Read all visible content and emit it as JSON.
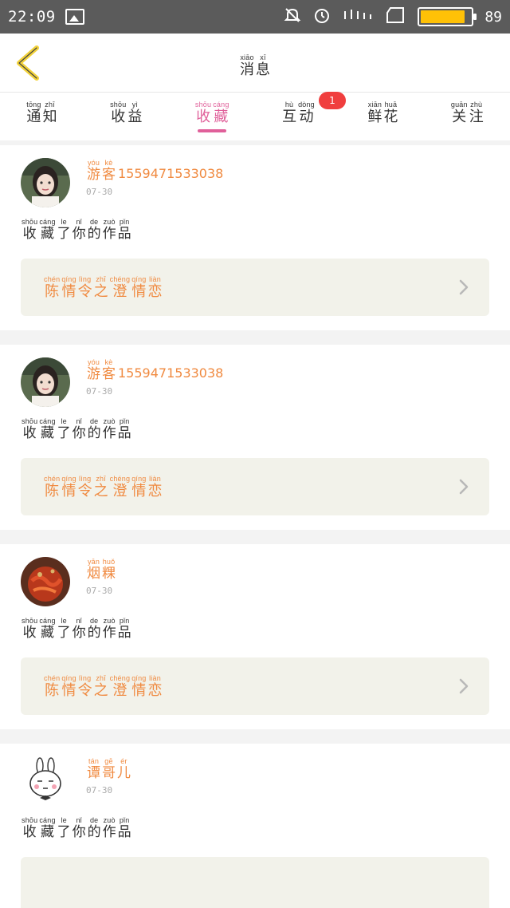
{
  "status": {
    "time": "22:09",
    "battery": "89",
    "battery_level": 0.89
  },
  "header": {
    "title_py": [
      "xiāo",
      "xī"
    ],
    "title_hz": [
      "消",
      "息"
    ]
  },
  "tabs": [
    {
      "py": [
        "tōng",
        "zhī"
      ],
      "hz": [
        "通",
        "知"
      ],
      "active": false
    },
    {
      "py": [
        "shōu",
        "yì"
      ],
      "hz": [
        "收",
        "益"
      ],
      "active": false
    },
    {
      "py": [
        "shōu",
        "cáng"
      ],
      "hz": [
        "收",
        "藏"
      ],
      "active": true
    },
    {
      "py": [
        "hù",
        "dòng"
      ],
      "hz": [
        "互",
        "动"
      ],
      "active": false,
      "badge": "1"
    },
    {
      "py": [
        "xiān",
        "huā"
      ],
      "hz": [
        "鲜",
        "花"
      ],
      "active": false
    },
    {
      "py": [
        "guān",
        "zhù"
      ],
      "hz": [
        "关",
        "注"
      ],
      "active": false
    }
  ],
  "items": [
    {
      "avatar": "girl-photo",
      "name_py": [
        "yóu",
        "kè"
      ],
      "name_hz": [
        "游",
        "客"
      ],
      "name_suffix": "15594715330 38",
      "date": "07-30",
      "action_py": [
        "shōu",
        "cáng",
        "le",
        "nǐ",
        "de",
        "zuò",
        "pǐn"
      ],
      "action_hz": [
        "收",
        "藏",
        "了",
        "你",
        "的",
        "作",
        "品"
      ],
      "work_py": [
        "chén",
        "qíng",
        "lìng",
        "zhī",
        "chéng",
        "qíng",
        "liàn"
      ],
      "work_hz": [
        "陈",
        "情",
        "令",
        "之",
        "澄",
        "情",
        "恋"
      ]
    },
    {
      "avatar": "girl-photo",
      "name_py": [
        "yóu",
        "kè"
      ],
      "name_hz": [
        "游",
        "客"
      ],
      "name_suffix": "15594715330 38",
      "date": "07-30",
      "action_py": [
        "shōu",
        "cáng",
        "le",
        "nǐ",
        "de",
        "zuò",
        "pǐn"
      ],
      "action_hz": [
        "收",
        "藏",
        "了",
        "你",
        "的",
        "作",
        "品"
      ],
      "work_py": [
        "chén",
        "qíng",
        "lìng",
        "zhī",
        "chéng",
        "qíng",
        "liàn"
      ],
      "work_hz": [
        "陈",
        "情",
        "令",
        "之",
        "澄",
        "情",
        "恋"
      ]
    },
    {
      "avatar": "food-photo",
      "name_py": [
        "yān",
        "huǒ"
      ],
      "name_hz": [
        "烟",
        "粿"
      ],
      "name_suffix": "",
      "date": "07-30",
      "action_py": [
        "shōu",
        "cáng",
        "le",
        "nǐ",
        "de",
        "zuò",
        "pǐn"
      ],
      "action_hz": [
        "收",
        "藏",
        "了",
        "你",
        "的",
        "作",
        "品"
      ],
      "work_py": [
        "chén",
        "qíng",
        "lìng",
        "zhī",
        "chéng",
        "qíng",
        "liàn"
      ],
      "work_hz": [
        "陈",
        "情",
        "令",
        "之",
        "澄",
        "情",
        "恋"
      ]
    },
    {
      "avatar": "rabbit-cartoon",
      "name_py": [
        "tán",
        "gē",
        "ér"
      ],
      "name_hz": [
        "谭",
        "哥",
        "儿"
      ],
      "name_suffix": "",
      "date": "07-30",
      "action_py": [
        "shōu",
        "cáng",
        "le",
        "nǐ",
        "de",
        "zuò",
        "pǐn"
      ],
      "action_hz": [
        "收",
        "藏",
        "了",
        "你",
        "的",
        "作",
        "品"
      ],
      "work_py": [],
      "work_hz": []
    }
  ],
  "colors": {
    "accent": "#e0609a",
    "orange": "#f08a40",
    "badge": "#f03e3e",
    "back": "#f2d23a"
  },
  "icons": [
    "back-chevron-icon",
    "chevron-right-icon",
    "mute-icon",
    "alarm-icon",
    "signal-icon",
    "battery-icon"
  ]
}
